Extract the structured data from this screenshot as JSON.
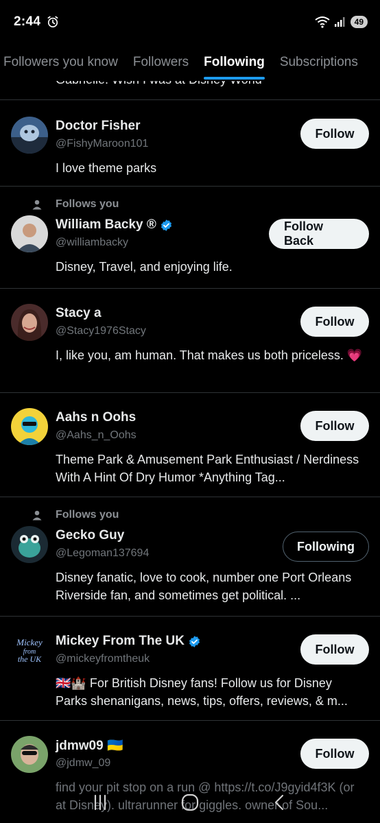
{
  "status_bar": {
    "time": "2:44",
    "battery": "49",
    "network": "7"
  },
  "tabs": [
    {
      "label": "Followers you know",
      "active": false
    },
    {
      "label": "Followers",
      "active": false
    },
    {
      "label": "Following",
      "active": true
    },
    {
      "label": "Subscriptions",
      "active": false
    }
  ],
  "peek_text": "Gabrielle. Wish I was at Disney World",
  "follows_you_label": "Follows you",
  "users": [
    {
      "name": "Doctor Fisher",
      "handle": "@FishyMaroon101",
      "bio": "I love theme parks",
      "button": "Follow",
      "verified": false,
      "follows_you": false
    },
    {
      "name": "William Backy ®",
      "handle": "@williambacky",
      "bio": "Disney, Travel, and enjoying life.",
      "button": "Follow Back",
      "verified": true,
      "follows_you": true
    },
    {
      "name": "Stacy a",
      "handle": "@Stacy1976Stacy",
      "bio": "I, like you, am human.  That makes us both priceless. 💗",
      "button": "Follow",
      "verified": false,
      "follows_you": false
    },
    {
      "name": "Aahs n Oohs",
      "handle": "@Aahs_n_Oohs",
      "bio": "Theme Park & Amusement Park Enthusiast / Nerdiness With A Hint Of Dry Humor *Anything Tag...",
      "button": "Follow",
      "verified": false,
      "follows_you": false
    },
    {
      "name": "Gecko Guy",
      "handle": "@Legoman137694",
      "bio": "Disney fanatic, love to cook, number one Port Orleans Riverside fan, and sometimes get political. ...",
      "button": "Following",
      "verified": false,
      "follows_you": true
    },
    {
      "name": "Mickey From The UK",
      "handle": "@mickeyfromtheuk",
      "bio": "🇬🇧🏰 For British Disney fans! Follow us for Disney Parks shenanigans, news, tips, offers, reviews, & m...",
      "button": "Follow",
      "verified": true,
      "follows_you": false
    },
    {
      "name": "jdmw09 🇺🇦",
      "handle": "@jdmw_09",
      "bio": "find your pit stop on a run @ https://t.co/J9gyid4f3K (or at Disney). ultrarunner for giggles. owner of Sou...",
      "button": "Follow",
      "verified": false,
      "follows_you": false
    }
  ],
  "avatar_logo_text": "Mickey from the UK",
  "colors": {
    "accent": "#1d9bf0",
    "background": "#000000",
    "divider": "#2f3336",
    "secondary_text": "#71767b"
  }
}
